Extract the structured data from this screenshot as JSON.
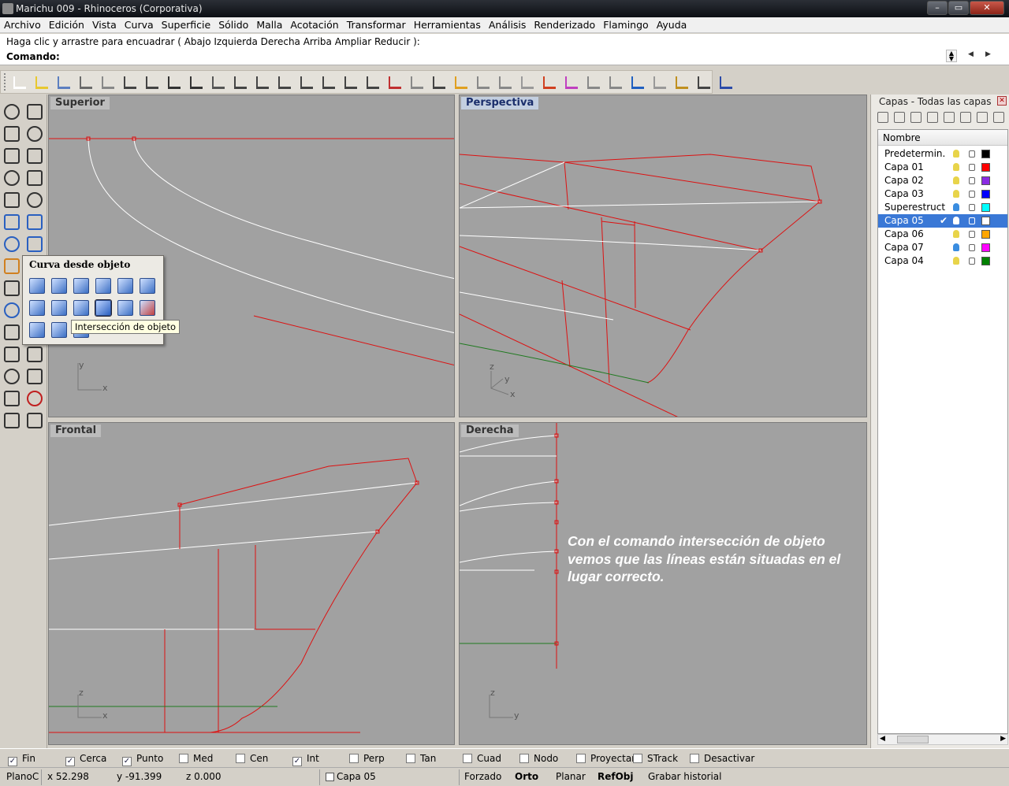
{
  "window": {
    "title": "Marichu 009 - Rhinoceros (Corporativa)",
    "min_icon": "minimize-icon",
    "max_icon": "maximize-icon",
    "close_glyph": "✕"
  },
  "menu": [
    "Archivo",
    "Edición",
    "Vista",
    "Curva",
    "Superficie",
    "Sólido",
    "Malla",
    "Acotación",
    "Transformar",
    "Herramientas",
    "Análisis",
    "Renderizado",
    "Flamingo",
    "Ayuda"
  ],
  "command": {
    "history": "Haga clic y arrastre para encuadrar ( Abajo  Izquierda  Derecha  Arriba  Ampliar  Reducir ):",
    "prompt": "Comando:",
    "input_value": ""
  },
  "viewports": {
    "superior": {
      "label": "Superior",
      "axis_x": "x",
      "axis_y": "y"
    },
    "perspectiva": {
      "label": "Perspectiva",
      "axis_x": "x",
      "axis_y": "y",
      "axis_z": "z"
    },
    "frontal": {
      "label": "Frontal",
      "axis_x": "x",
      "axis_z": "z"
    },
    "derecha": {
      "label": "Derecha",
      "axis_y": "y",
      "axis_z": "z"
    }
  },
  "annotation": "Con el comando intersección de objeto vemos que las líneas están situadas en el lugar correcto.",
  "flyout": {
    "title": "Curva desde objeto",
    "tooltip": "Intersección de objeto"
  },
  "layers": {
    "title": "Capas - Todas las capas",
    "column_name": "Nombre",
    "rows": [
      {
        "name": "Predetermin...",
        "color": "#000000",
        "current": false,
        "bulb": "#e8d44a"
      },
      {
        "name": "Capa 01",
        "color": "#ff0000",
        "current": false,
        "bulb": "#e8d44a"
      },
      {
        "name": "Capa 02",
        "color": "#8a2be2",
        "current": false,
        "bulb": "#e8d44a"
      },
      {
        "name": "Capa 03",
        "color": "#0000ff",
        "current": false,
        "bulb": "#e8d44a"
      },
      {
        "name": "Superestruct...",
        "color": "#00ffff",
        "current": false,
        "bulb": "#3a8de0"
      },
      {
        "name": "Capa 05",
        "color": "#ffffff",
        "current": true,
        "bulb": "#ffffff"
      },
      {
        "name": "Capa 06",
        "color": "#ffa500",
        "current": false,
        "bulb": "#e8d44a"
      },
      {
        "name": "Capa 07",
        "color": "#ff00ff",
        "current": false,
        "bulb": "#3a8de0"
      },
      {
        "name": "Capa 04",
        "color": "#008000",
        "current": false,
        "bulb": "#e8d44a"
      }
    ],
    "check_glyph": "✔"
  },
  "osnaps": [
    {
      "label": "Fin",
      "checked": true
    },
    {
      "label": "Cerca",
      "checked": true
    },
    {
      "label": "Punto",
      "checked": true
    },
    {
      "label": "Med",
      "checked": false
    },
    {
      "label": "Cen",
      "checked": false
    },
    {
      "label": "Int",
      "checked": true
    },
    {
      "label": "Perp",
      "checked": false
    },
    {
      "label": "Tan",
      "checked": false
    },
    {
      "label": "Cuad",
      "checked": false
    },
    {
      "label": "Nodo",
      "checked": false
    },
    {
      "label": "Proyectar",
      "checked": false
    },
    {
      "label": "STrack",
      "checked": false
    },
    {
      "label": "Desactivar",
      "checked": false
    }
  ],
  "status": {
    "cplane": "PlanoC",
    "x": "x 52.298",
    "y": "y -91.399",
    "z": "z 0.000",
    "layer": "Capa 05",
    "forzado": "Forzado",
    "orto": "Orto",
    "planar": "Planar",
    "refobj": "RefObj",
    "historial": "Grabar historial"
  }
}
